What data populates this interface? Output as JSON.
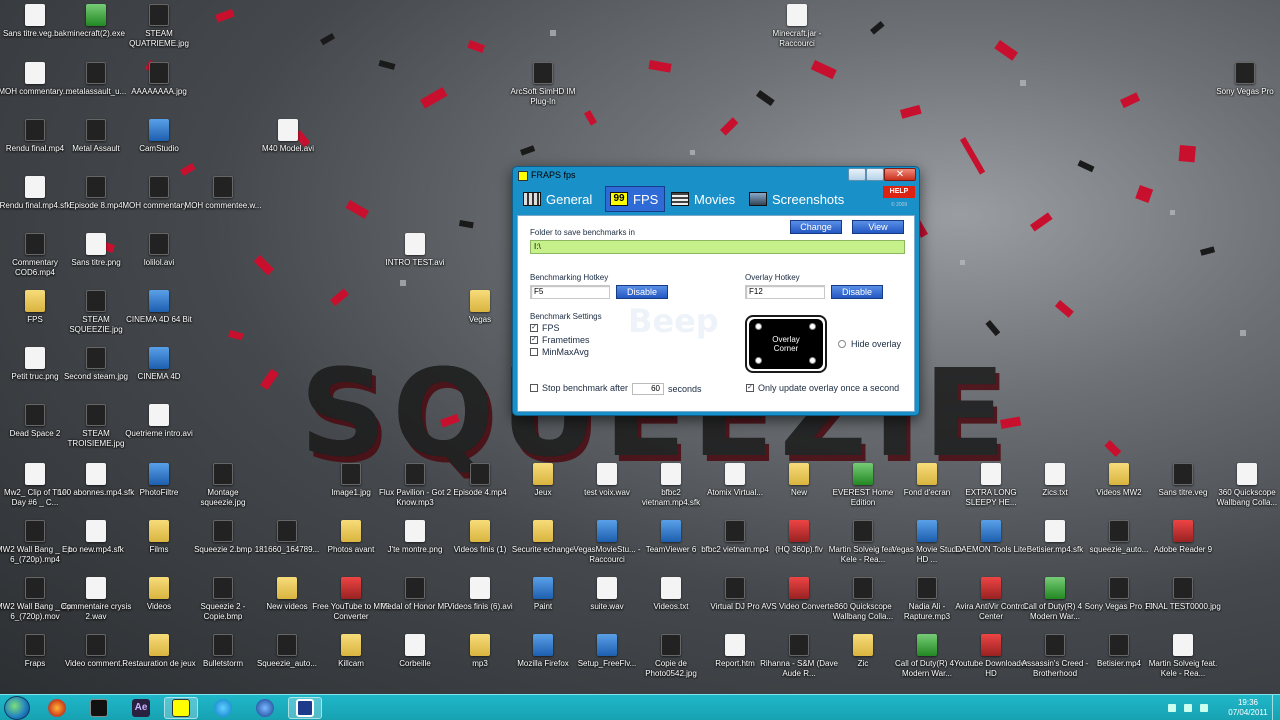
{
  "desktop": {
    "icons": [
      {
        "label": "Sans titre.veg.bak",
        "type": "file"
      },
      {
        "label": "minecraft(2).exe",
        "type": "green"
      },
      {
        "label": "STEAM QUATRIEME.jpg",
        "type": "dark"
      },
      {
        "label": "MOH commentary....",
        "type": "file"
      },
      {
        "label": "metalassault_u...",
        "type": "dark"
      },
      {
        "label": "AAAAAAAA.jpg",
        "type": "dark"
      },
      {
        "label": "Rendu final.mp4",
        "type": "dark"
      },
      {
        "label": "Metal Assault",
        "type": "dark"
      },
      {
        "label": "CamStudio",
        "type": "app"
      },
      {
        "label": "M40 Model.avi",
        "type": "file"
      },
      {
        "label": "Rendu final.mp4.sfk",
        "type": "file"
      },
      {
        "label": "Episode 8.mp4",
        "type": "dark"
      },
      {
        "label": "MOH commentary....",
        "type": "dark"
      },
      {
        "label": "MOH commentee.w...",
        "type": "dark"
      },
      {
        "label": "Commentary COD6.mp4",
        "type": "dark"
      },
      {
        "label": "Sans titre.png",
        "type": "file"
      },
      {
        "label": "lolilol.avi",
        "type": "dark"
      },
      {
        "label": "INTRO TEST.avi",
        "type": "file"
      },
      {
        "label": "FPS",
        "type": "folder"
      },
      {
        "label": "STEAM SQUEEZIE.jpg",
        "type": "dark"
      },
      {
        "label": "CINEMA 4D 64 Bit",
        "type": "app"
      },
      {
        "label": "Vegas",
        "type": "folder"
      },
      {
        "label": "Petit truc.png",
        "type": "file"
      },
      {
        "label": "Second steam.jpg",
        "type": "dark"
      },
      {
        "label": "CINEMA 4D",
        "type": "app"
      },
      {
        "label": "Dead Space 2",
        "type": "dark"
      },
      {
        "label": "STEAM TROISIEME.jpg",
        "type": "dark"
      },
      {
        "label": "Quetrieme intro.avi",
        "type": "file"
      },
      {
        "label": "Minecraft.jar - Raccourci",
        "type": "file"
      },
      {
        "label": "ArcSoft SimHD IM Plug-In",
        "type": "dark"
      },
      {
        "label": "Sony Vegas Pro",
        "type": "dark"
      },
      {
        "label": "Mw2_ Clip of The Day #6 _ C...",
        "type": "file"
      },
      {
        "label": "100 abonnes.mp4.sfk",
        "type": "file"
      },
      {
        "label": "PhotoFiltre",
        "type": "app"
      },
      {
        "label": "Montage squeezie.jpg",
        "type": "dark"
      },
      {
        "label": "Image1.jpg",
        "type": "dark"
      },
      {
        "label": "Flux Pavilion - Got 2 Know.mp3",
        "type": "dark"
      },
      {
        "label": "Episode 4.mp4",
        "type": "dark"
      },
      {
        "label": "Jeux",
        "type": "folder"
      },
      {
        "label": "test voix.wav",
        "type": "file"
      },
      {
        "label": "bfbc2 vietnam.mp4.sfk",
        "type": "file"
      },
      {
        "label": "Atomix Virtual...",
        "type": "file"
      },
      {
        "label": "New",
        "type": "folder"
      },
      {
        "label": "EVEREST Home Edition",
        "type": "green"
      },
      {
        "label": "Fond d'ecran",
        "type": "folder"
      },
      {
        "label": "EXTRA LONG SLEEPY HE...",
        "type": "file"
      },
      {
        "label": "Zics.txt",
        "type": "file"
      },
      {
        "label": "Videos MW2",
        "type": "folder"
      },
      {
        "label": "Sans titre.veg",
        "type": "dark"
      },
      {
        "label": "360 Quickscope Wallbang Colla...",
        "type": "file"
      },
      {
        "label": "MW2 Wall Bang _ Ep. 6_(720p).mp4",
        "type": "dark"
      },
      {
        "label": "bo new.mp4.sfk",
        "type": "file"
      },
      {
        "label": "Films",
        "type": "folder"
      },
      {
        "label": "Squeezie 2.bmp",
        "type": "dark"
      },
      {
        "label": "181660_164789...",
        "type": "dark"
      },
      {
        "label": "Photos avant",
        "type": "folder"
      },
      {
        "label": "J'te montre.png",
        "type": "file"
      },
      {
        "label": "Videos finis (1)",
        "type": "folder"
      },
      {
        "label": "Securite echange",
        "type": "folder"
      },
      {
        "label": "VegasMovieStu... - Raccourci",
        "type": "app"
      },
      {
        "label": "TeamViewer 6",
        "type": "app"
      },
      {
        "label": "bfbc2 vietnam.mp4",
        "type": "dark"
      },
      {
        "label": "(HQ 360p).flv",
        "type": "red"
      },
      {
        "label": "Martin Solveig feat. Kele - Rea...",
        "type": "dark"
      },
      {
        "label": "Vegas Movie Studio HD ...",
        "type": "app"
      },
      {
        "label": "DAEMON Tools Lite",
        "type": "app"
      },
      {
        "label": "Betisier.mp4.sfk",
        "type": "file"
      },
      {
        "label": "squeezie_auto...",
        "type": "dark"
      },
      {
        "label": "Adobe Reader 9",
        "type": "red"
      },
      {
        "label": "MW2 Wall Bang _ Ep. 6_(720p).mov",
        "type": "dark"
      },
      {
        "label": "Commentaire crysis 2.wav",
        "type": "file"
      },
      {
        "label": "Videos",
        "type": "folder"
      },
      {
        "label": "Squeezie 2 - Copie.bmp",
        "type": "dark"
      },
      {
        "label": "New videos",
        "type": "folder"
      },
      {
        "label": "Free YouTube to MP3 Converter",
        "type": "red"
      },
      {
        "label": "Medal of Honor MP",
        "type": "dark"
      },
      {
        "label": "Videos finis (6).avi",
        "type": "file"
      },
      {
        "label": "Paint",
        "type": "app"
      },
      {
        "label": "suite.wav",
        "type": "file"
      },
      {
        "label": "Videos.txt",
        "type": "file"
      },
      {
        "label": "Virtual DJ Pro",
        "type": "dark"
      },
      {
        "label": "AVS Video Converter",
        "type": "red"
      },
      {
        "label": "360 Quickscope Wallbang Colla...",
        "type": "dark"
      },
      {
        "label": "Nadia Ali - Rapture.mp3",
        "type": "dark"
      },
      {
        "label": "Avira AntiVir Control Center",
        "type": "red"
      },
      {
        "label": "Call of Duty(R) 4 - Modern War...",
        "type": "green"
      },
      {
        "label": "Sony Vegas Pro 10",
        "type": "dark"
      },
      {
        "label": "FINAL TEST0000.jpg",
        "type": "dark"
      },
      {
        "label": "Fraps",
        "type": "dark"
      },
      {
        "label": "Video comment...",
        "type": "dark"
      },
      {
        "label": "Restauration de jeux",
        "type": "folder"
      },
      {
        "label": "Bulletstorm",
        "type": "dark"
      },
      {
        "label": "Squeezie_auto...",
        "type": "dark"
      },
      {
        "label": "Killcam",
        "type": "folder"
      },
      {
        "label": "Corbeille",
        "type": "file"
      },
      {
        "label": "mp3",
        "type": "folder"
      },
      {
        "label": "Mozilla Firefox",
        "type": "app"
      },
      {
        "label": "Setup_FreeFlv...",
        "type": "app"
      },
      {
        "label": "Copie de Photo0542.jpg",
        "type": "dark"
      },
      {
        "label": "Report.htm",
        "type": "file"
      },
      {
        "label": "Rihanna - S&M (Dave Aude R...",
        "type": "dark"
      },
      {
        "label": "Zic",
        "type": "folder"
      },
      {
        "label": "Call of Duty(R) 4 - Modern War...",
        "type": "green"
      },
      {
        "label": "Youtube Downloader HD",
        "type": "red"
      },
      {
        "label": "Assassin's Creed - Brotherhood",
        "type": "dark"
      },
      {
        "label": "Betisier.mp4",
        "type": "dark"
      },
      {
        "label": "Martin Solveig feat. Kele - Rea...",
        "type": "file"
      }
    ]
  },
  "fraps": {
    "title": "FRAPS fps",
    "tabs": {
      "general": "General",
      "fps": "FPS",
      "movies": "Movies",
      "screenshots": "Screenshots",
      "fps_icon": "99"
    },
    "help": "HELP",
    "copyright": "© 2009",
    "folder_label": "Folder to save benchmarks in",
    "folder_value": "I:\\",
    "change_btn": "Change",
    "view_btn": "View",
    "bench_hotkey_label": "Benchmarking Hotkey",
    "bench_hotkey_value": "F5",
    "overlay_hotkey_label": "Overlay Hotkey",
    "overlay_hotkey_value": "F12",
    "disable_btn": "Disable",
    "bench_settings_label": "Benchmark Settings",
    "chk_fps": "FPS",
    "chk_frametimes": "Frametimes",
    "chk_minmaxavg": "MinMaxAvg",
    "stop_bench_label": "Stop benchmark after",
    "stop_bench_value": "60",
    "seconds_label": "seconds",
    "overlay_corner_1": "Overlay",
    "overlay_corner_2": "Corner",
    "hide_overlay": "Hide overlay",
    "update_once": "Only update overlay once a second",
    "watermark": "Beep"
  },
  "taskbar": {
    "clock_time": "19:36",
    "clock_date": "07/04/2011",
    "apps": [
      "firefox-icon",
      "terminal-icon",
      "after-effects-icon",
      "fraps-icon",
      "skype-icon",
      "firefox-blue-icon",
      "fraps-window-icon"
    ],
    "ae_label": "Ae"
  },
  "wallpaper_text": "SQUEEZIE"
}
